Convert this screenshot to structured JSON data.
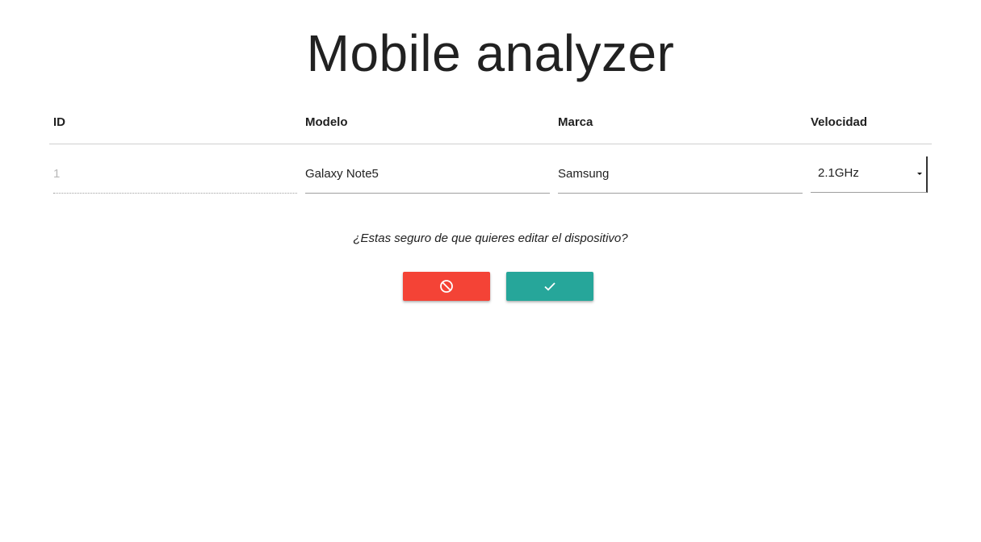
{
  "app": {
    "title": "Mobile analyzer"
  },
  "table": {
    "headers": {
      "id": "ID",
      "modelo": "Modelo",
      "marca": "Marca",
      "velocidad": "Velocidad"
    },
    "row": {
      "id": "1",
      "modelo": "Galaxy Note5",
      "marca": "Samsung",
      "velocidad": "2.1GHz"
    }
  },
  "confirmation": {
    "message": "¿Estas seguro de que quieres editar el dispositivo?",
    "cancel_icon": "block-icon",
    "confirm_icon": "check-icon"
  },
  "colors": {
    "cancel": "#f44336",
    "confirm": "#26a69a"
  }
}
